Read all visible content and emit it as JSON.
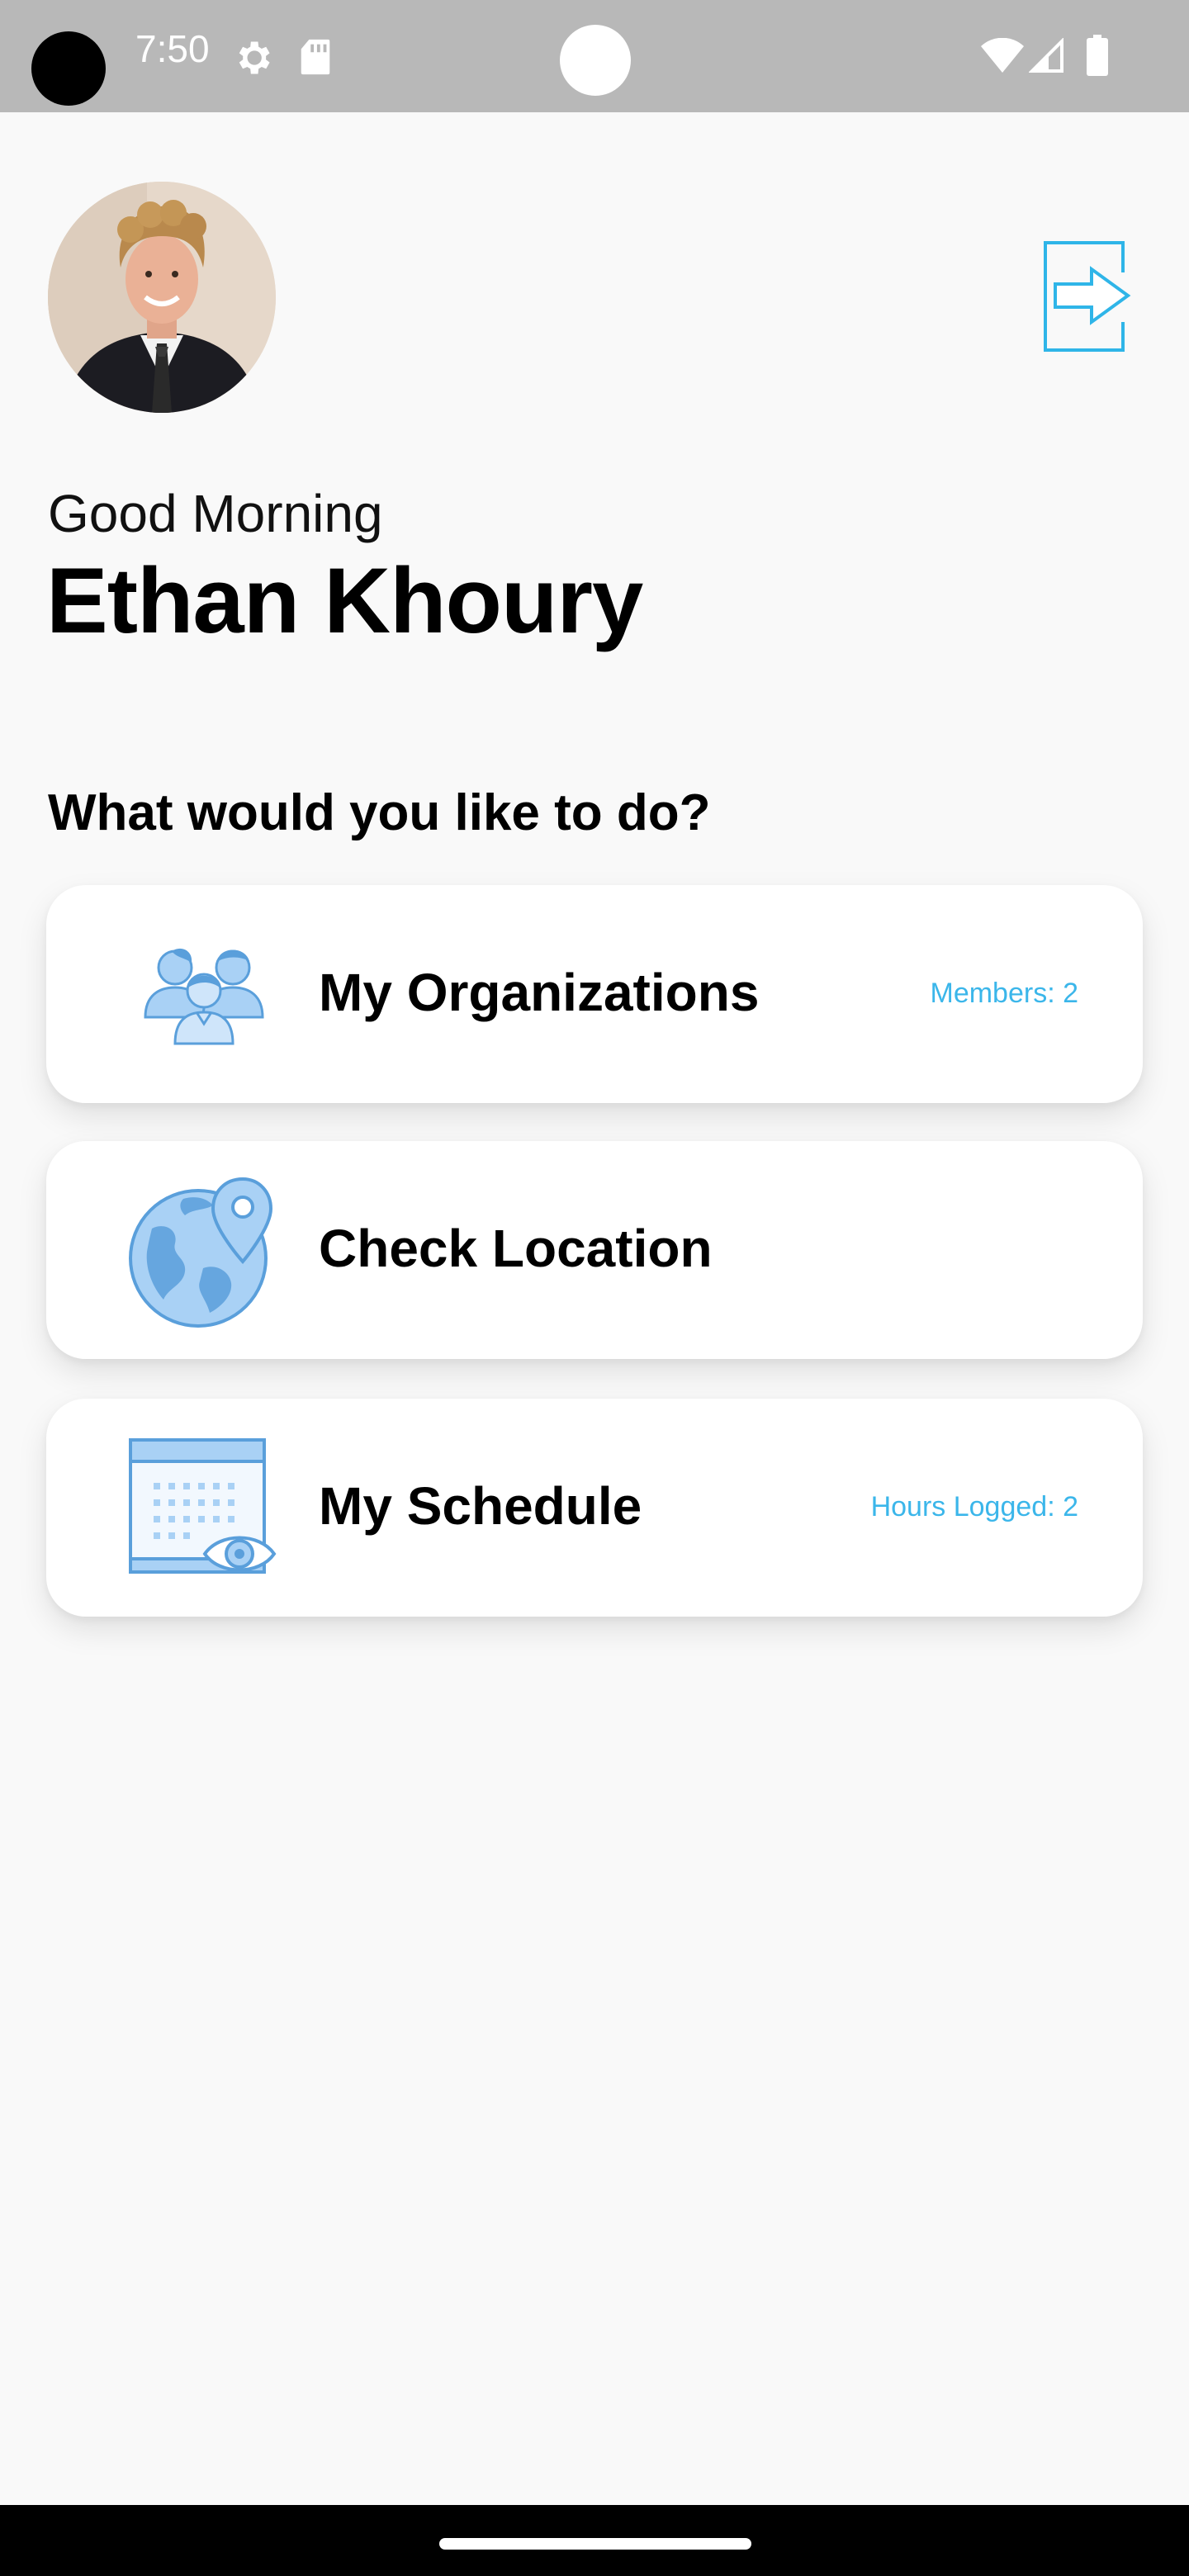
{
  "status_bar": {
    "time": "7:50",
    "icons": [
      "gear-icon",
      "sd-card-icon",
      "wifi-icon",
      "signal-icon",
      "battery-icon"
    ]
  },
  "header": {
    "avatar": "profile-photo",
    "logout_icon": "logout-icon"
  },
  "greeting": "Good Morning",
  "user_name": "Ethan Khoury",
  "prompt": "What would you like to do?",
  "cards": [
    {
      "title": "My Organizations",
      "badge": "Members: 2",
      "icon": "group-icon"
    },
    {
      "title": "Check Location",
      "badge": "",
      "icon": "globe-location-icon"
    },
    {
      "title": "My Schedule",
      "badge": "Hours Logged: 2",
      "icon": "calendar-view-icon"
    }
  ],
  "colors": {
    "accent": "#3bb6ea",
    "icon_blue": "#5a9fdb",
    "icon_fill": "#a9d1f5",
    "background": "#f9f9f9",
    "status_bar": "#b8b8b8"
  }
}
